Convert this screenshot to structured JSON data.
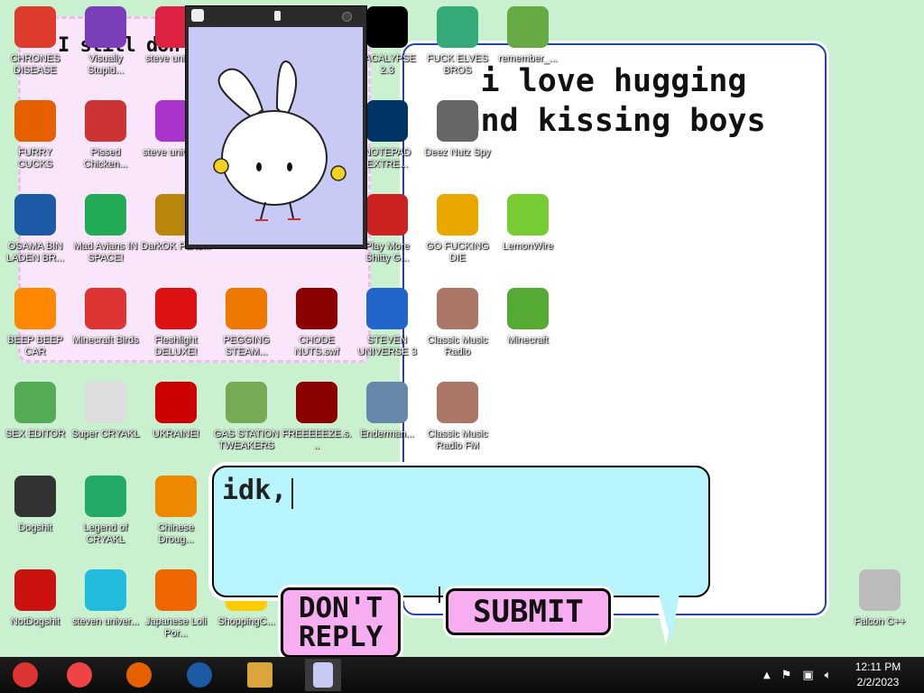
{
  "bubbles": {
    "pink_text": "I still don't",
    "white_text": "i love hugging and kissing boys"
  },
  "icons": [
    {
      "label": "CHRONES DISEASE",
      "icon": "chrome-icon",
      "color": "#dd3b2c"
    },
    {
      "label": "Visually Stupid...",
      "icon": "visual-studio-icon",
      "color": "#7a3fb8"
    },
    {
      "label": "steve univer...",
      "icon": "gem-icon",
      "color": "#d24"
    },
    {
      "label": "PACALYPSE 2.3",
      "icon": "terminal-icon",
      "color": "#000"
    },
    {
      "label": "FUCK ELVES BROS",
      "icon": "elf-icon",
      "color": "#3a7"
    },
    {
      "label": "remember_...",
      "icon": "folder-icon",
      "color": "#6a4"
    },
    {
      "label": "FURRY CUCKS",
      "icon": "firefox-icon",
      "color": "#e66000"
    },
    {
      "label": "Pissed Chicken...",
      "icon": "angry-birds-seasons-icon",
      "color": "#c33"
    },
    {
      "label": "steve univers...",
      "icon": "gem-icon",
      "color": "#a3c"
    },
    {
      "label": "NOTEPAD EXTRE...",
      "icon": "notepad-icon",
      "color": "#036"
    },
    {
      "label": "Deez Nutz Spy",
      "icon": "copy-icon",
      "color": "#666"
    },
    {
      "label": "OSAMA BIN LADEN BR...",
      "icon": "obama-logo-icon",
      "color": "#1d5aa6"
    },
    {
      "label": "Mad Avians IN SPACE!",
      "icon": "angry-birds-space-icon",
      "color": "#2a5"
    },
    {
      "label": "DarkOK Parte...",
      "icon": "money-bag-icon",
      "color": "#b8860b"
    },
    {
      "label": "Play More Shitty G...",
      "icon": "popcap-icon",
      "color": "#c22"
    },
    {
      "label": "GO FUCKING DIE",
      "icon": "de-icon",
      "color": "#e8a800"
    },
    {
      "label": "LemonWire",
      "icon": "limewire-icon",
      "color": "#7c3"
    },
    {
      "label": "BEEP BEEP CAR",
      "icon": "vlc-icon",
      "color": "#f80"
    },
    {
      "label": "Minecraft Birds",
      "icon": "angry-bird-icon",
      "color": "#d33"
    },
    {
      "label": "Fleshlight DELUXE!",
      "icon": "red-puff-icon",
      "color": "#d11"
    },
    {
      "label": "PEGGING STEAM...",
      "icon": "pegasus-icon",
      "color": "#e70"
    },
    {
      "label": "CHODE NUTS.swf",
      "icon": "flash-icon",
      "color": "#8b0000"
    },
    {
      "label": "STEVEN UNIVERSE 3",
      "icon": "three-icon",
      "color": "#26c"
    },
    {
      "label": "Classic Music Radio",
      "icon": "portrait-icon",
      "color": "#a76"
    },
    {
      "label": "Minecraft",
      "icon": "grass-block-icon",
      "color": "#5a3"
    },
    {
      "label": "SEX EDITOR",
      "icon": "hxd-icon",
      "color": "#5a5"
    },
    {
      "label": "Super CRYAKL",
      "icon": "pixel-dog-icon",
      "color": "#ddd"
    },
    {
      "label": "UKRAINE!",
      "icon": "radiation-icon",
      "color": "#c00"
    },
    {
      "label": "GAS STATION TWEAKERS",
      "icon": "plant-icon",
      "color": "#7a5"
    },
    {
      "label": "FREEEEEZE.s...",
      "icon": "flash-icon",
      "color": "#8b0000"
    },
    {
      "label": "Enderman...",
      "icon": "diamond-block-icon",
      "color": "#68a"
    },
    {
      "label": "Classic Music Radio FM",
      "icon": "portrait-icon",
      "color": "#a76"
    },
    {
      "label": "Dogshit",
      "icon": "cpp-icon",
      "color": "#333"
    },
    {
      "label": "Legend of CRYAKL",
      "icon": "ninja-icon",
      "color": "#2a6"
    },
    {
      "label": "Chinese Droug...",
      "icon": "mahjong-icon",
      "color": "#e80"
    },
    {
      "label": "NotDogshit",
      "icon": "devcpp-icon",
      "color": "#c11"
    },
    {
      "label": "steven univer...",
      "icon": "diamond-icon",
      "color": "#2bd"
    },
    {
      "label": "Japanese Loli Por...",
      "icon": "torii-icon",
      "color": "#e60"
    },
    {
      "label": "ShoppingC...",
      "icon": "shopping-icon",
      "color": "#fc0"
    },
    {
      "label": "Falcon C++",
      "icon": "recycle-bin-icon",
      "color": "#bbb"
    }
  ],
  "bunny_window": {
    "title_icon": "bunny-icon",
    "min_label": "‸"
  },
  "reply": {
    "text": "idk,",
    "dont_reply": "DON'T REPLY",
    "submit": "SUBMIT"
  },
  "taskbar": {
    "apps": [
      "chrome-alt-icon",
      "chrome-icon",
      "firefox-icon",
      "obama-logo-icon",
      "file-explorer-icon",
      "bunny-icon"
    ],
    "time": "12:11 PM",
    "date": "2/2/2023"
  }
}
